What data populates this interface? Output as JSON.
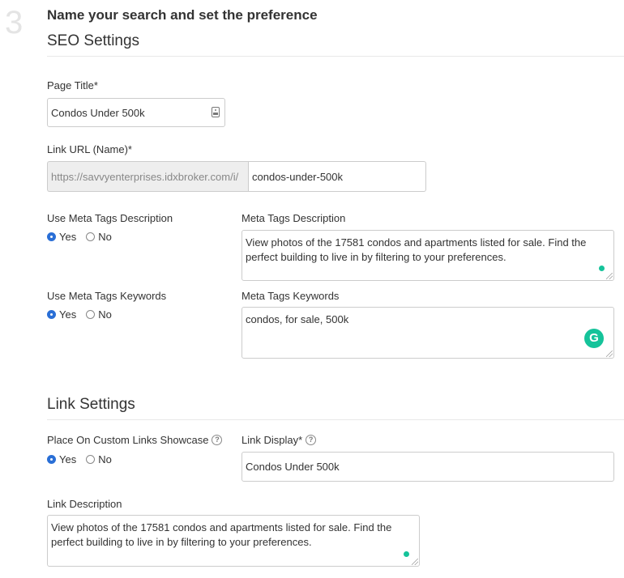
{
  "step": {
    "number": "3",
    "title": "Name your search and set the preference"
  },
  "seo": {
    "heading": "SEO Settings",
    "page_title": {
      "label": "Page Title*",
      "value": "Condos Under 500k"
    },
    "link_url": {
      "label": "Link URL (Name)*",
      "prefix": "https://savvyenterprises.idxbroker.com/i/",
      "value": "condos-under-500k"
    },
    "meta_desc_toggle": {
      "label": "Use Meta Tags Description",
      "yes": "Yes",
      "no": "No",
      "selected": "Yes"
    },
    "meta_desc": {
      "label": "Meta Tags Description",
      "value": "View photos of the 17581 condos and apartments listed for sale. Find the perfect building to live in by filtering to your preferences."
    },
    "meta_kw_toggle": {
      "label": "Use Meta Tags Keywords",
      "yes": "Yes",
      "no": "No",
      "selected": "Yes"
    },
    "meta_kw": {
      "label": "Meta Tags Keywords",
      "value": "condos, for sale, 500k"
    }
  },
  "link": {
    "heading": "Link Settings",
    "showcase_toggle": {
      "label": "Place On Custom Links Showcase",
      "yes": "Yes",
      "no": "No",
      "selected": "Yes"
    },
    "display": {
      "label": "Link Display*",
      "value": "Condos Under 500k"
    },
    "description": {
      "label": "Link Description",
      "value": "View photos of the 17581 condos and apartments listed for sale. Find the perfect building to live in by filtering to your preferences."
    }
  },
  "icons": {
    "help": "?",
    "grammarly": "G"
  },
  "colors": {
    "radio_selected": "#2a6fd6",
    "grammarly_green": "#15c39a"
  }
}
